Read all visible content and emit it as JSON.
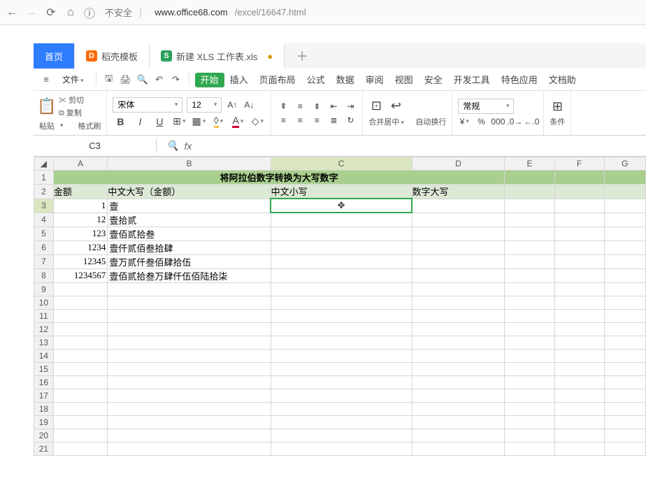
{
  "browser": {
    "insecure_label": "不安全",
    "url_host": "www.office68.com",
    "url_path": "/excel/16647.html"
  },
  "tabs": {
    "home": "首页",
    "template": "稻壳模板",
    "workbook": "新建 XLS 工作表.xls"
  },
  "menu": {
    "file": "文件",
    "items": [
      "开始",
      "插入",
      "页面布局",
      "公式",
      "数据",
      "审阅",
      "视图",
      "安全",
      "开发工具",
      "特色应用",
      "文档助"
    ]
  },
  "ribbon": {
    "paste": "粘贴",
    "cut": "剪切",
    "copy": "复制",
    "formatpaint": "格式刷",
    "font_name": "宋体",
    "font_size": "12",
    "merge": "合并居中",
    "wrap": "自动换行",
    "format": "常规",
    "cond": "条件"
  },
  "cellref": "C3",
  "columns": [
    "A",
    "B",
    "C",
    "D",
    "E",
    "F",
    "G"
  ],
  "rows_count": 21,
  "sheet": {
    "title": "将阿拉伯数字转换为大写数字",
    "headers": {
      "A": "金额",
      "B": "中文大写（金额）",
      "C": "中文小写",
      "D": "数字大写"
    },
    "data": [
      {
        "num": "1",
        "cn": "壹"
      },
      {
        "num": "12",
        "cn": "壹拾贰"
      },
      {
        "num": "123",
        "cn": "壹佰贰拾叁"
      },
      {
        "num": "1234",
        "cn": "壹仟贰佰叁拾肆"
      },
      {
        "num": "12345",
        "cn": "壹万贰仟叁佰肆拾伍"
      },
      {
        "num": "1234567",
        "cn": "壹佰贰拾叁万肆仟伍佰陆拾柒"
      }
    ]
  }
}
